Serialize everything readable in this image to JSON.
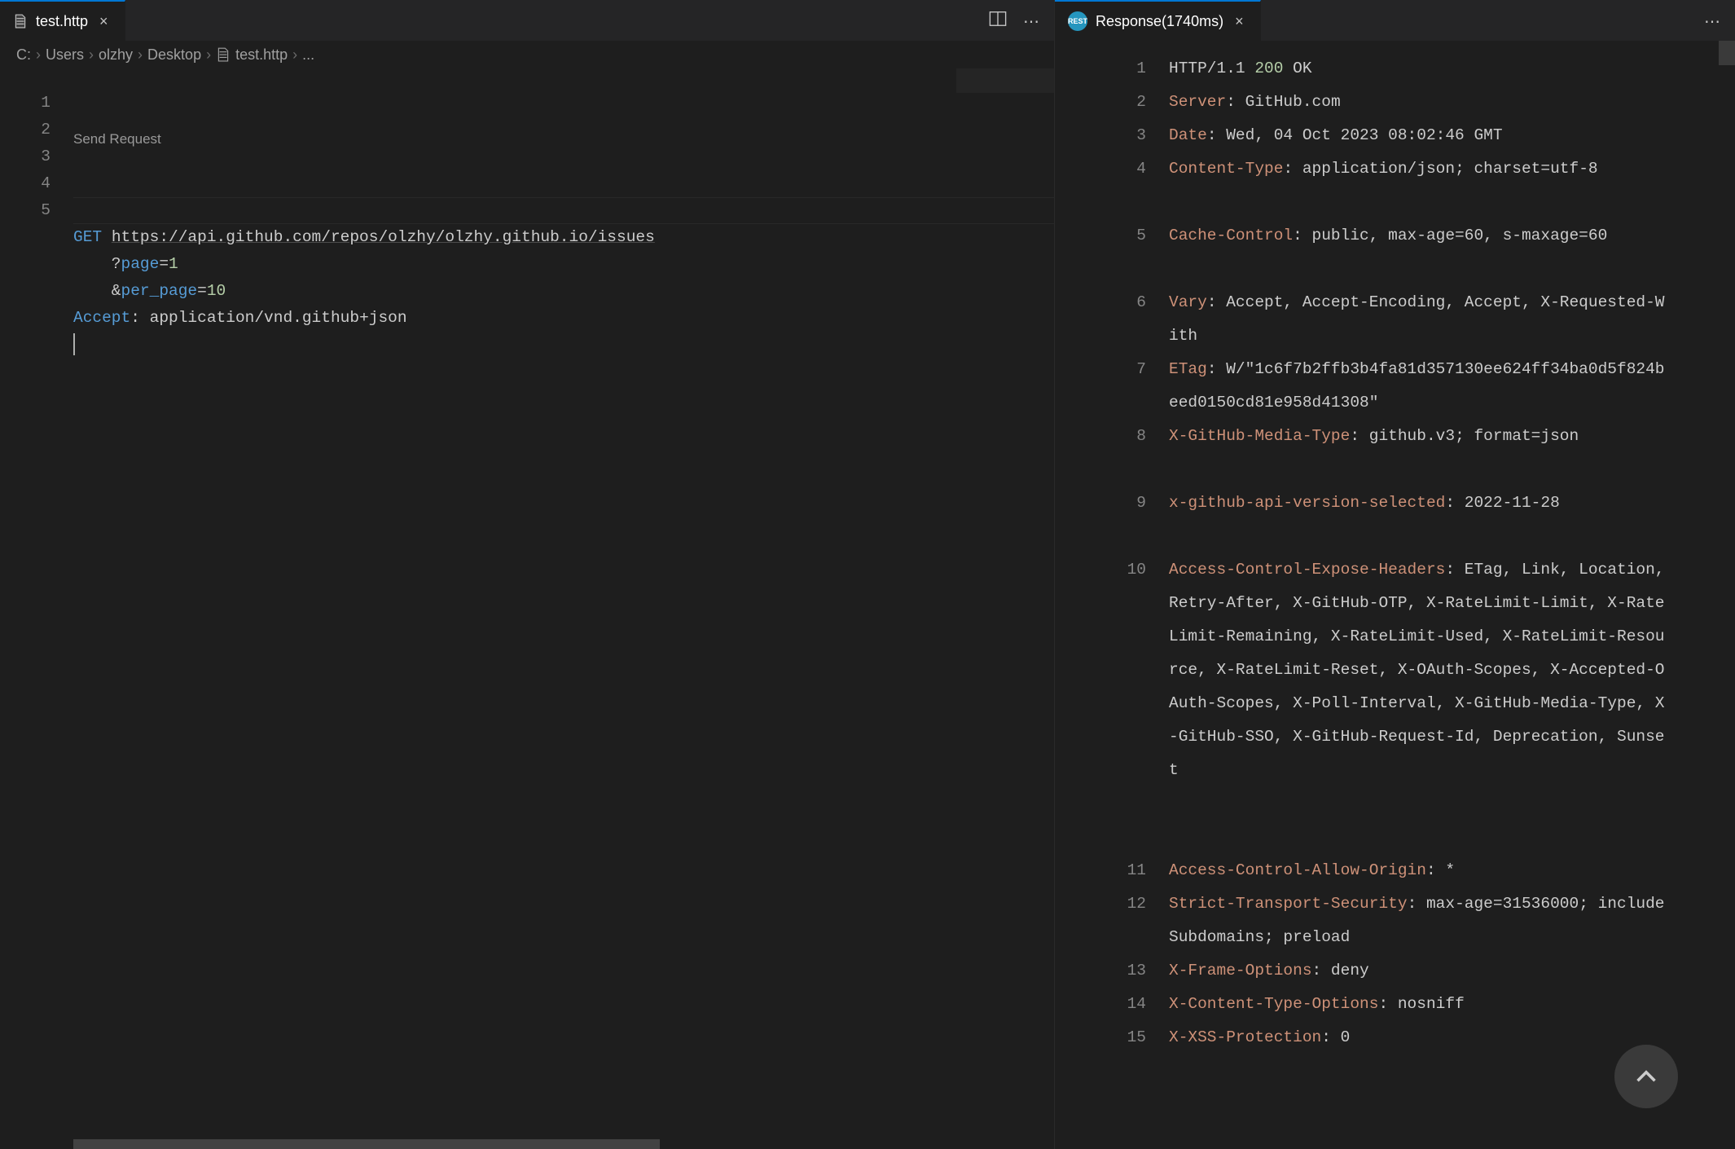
{
  "left": {
    "tab": {
      "label": "test.http",
      "icon": "file-icon"
    },
    "breadcrumbs": [
      "C:",
      "Users",
      "olzhy",
      "Desktop",
      "test.http",
      "..."
    ],
    "codelens": "Send Request",
    "lines": [
      {
        "n": 1,
        "tokens": [
          [
            "method",
            "GET"
          ],
          [
            "plain",
            " "
          ],
          [
            "url",
            "https://api.github.com/repos/olzhy/olzhy.github.io/issues"
          ]
        ]
      },
      {
        "n": 2,
        "tokens": [
          [
            "plain",
            "    ?"
          ],
          [
            "param",
            "page"
          ],
          [
            "plain",
            "="
          ],
          [
            "num",
            "1"
          ]
        ]
      },
      {
        "n": 3,
        "tokens": [
          [
            "plain",
            "    &"
          ],
          [
            "param",
            "per_page"
          ],
          [
            "plain",
            "="
          ],
          [
            "num",
            "10"
          ]
        ]
      },
      {
        "n": 4,
        "tokens": [
          [
            "header",
            "Accept"
          ],
          [
            "colon",
            ":"
          ],
          [
            "plain",
            " application/vnd.github+json"
          ]
        ]
      },
      {
        "n": 5,
        "tokens": []
      }
    ]
  },
  "right": {
    "tab": {
      "label": "Response(1740ms)",
      "icon": "rest-icon"
    },
    "lines": [
      {
        "n": 1,
        "kind": "status",
        "proto": "HTTP/1.1",
        "code": "200",
        "text": "OK"
      },
      {
        "n": 2,
        "kind": "h",
        "name": "Server",
        "value": "GitHub.com"
      },
      {
        "n": 3,
        "kind": "h",
        "name": "Date",
        "value": "Wed, 04 Oct 2023 08:02:46 GMT"
      },
      {
        "n": 4,
        "kind": "h",
        "name": "Content-Type",
        "value": "application/json; charset=utf-8"
      },
      {
        "n": 5,
        "kind": "h",
        "name": "Cache-Control",
        "value": "public, max-age=60, s-maxage=60"
      },
      {
        "n": 6,
        "kind": "h",
        "name": "Vary",
        "value": "Accept, Accept-Encoding, Accept, X-Requested-With"
      },
      {
        "n": 7,
        "kind": "h",
        "name": "ETag",
        "value": "W/\"1c6f7b2ffb3b4fa81d357130ee624ff34ba0d5f824beed0150cd81e958d41308\""
      },
      {
        "n": 8,
        "kind": "h",
        "name": "X-GitHub-Media-Type",
        "value": "github.v3; format=json"
      },
      {
        "n": 9,
        "kind": "h",
        "name": "x-github-api-version-selected",
        "value": "2022-11-28"
      },
      {
        "n": 10,
        "kind": "h",
        "name": "Access-Control-Expose-Headers",
        "value": "ETag, Link, Location, Retry-After, X-GitHub-OTP, X-RateLimit-Limit, X-RateLimit-Remaining, X-RateLimit-Used, X-RateLimit-Resource, X-RateLimit-Reset, X-OAuth-Scopes, X-Accepted-OAuth-Scopes, X-Poll-Interval, X-GitHub-Media-Type, X-GitHub-SSO, X-GitHub-Request-Id, Deprecation, Sunset"
      },
      {
        "n": 11,
        "kind": "h",
        "name": "Access-Control-Allow-Origin",
        "value": "*"
      },
      {
        "n": 12,
        "kind": "h",
        "name": "Strict-Transport-Security",
        "value": "max-age=31536000; includeSubdomains; preload"
      },
      {
        "n": 13,
        "kind": "h",
        "name": "X-Frame-Options",
        "value": "deny"
      },
      {
        "n": 14,
        "kind": "h",
        "name": "X-Content-Type-Options",
        "value": "nosniff"
      },
      {
        "n": 15,
        "kind": "h",
        "name": "X-XSS-Protection",
        "value": "0"
      }
    ]
  },
  "icons": {
    "close": "×",
    "split": "⬓",
    "more": "⋯",
    "chevron": "›",
    "up": "˄"
  }
}
